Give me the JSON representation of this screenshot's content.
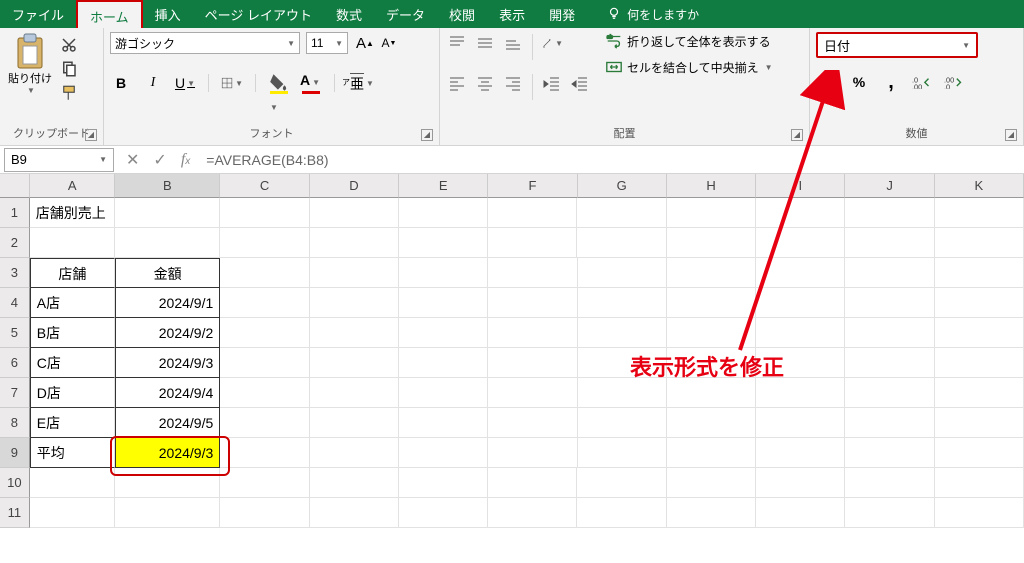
{
  "menubar": {
    "tabs": [
      "ファイル",
      "ホーム",
      "挿入",
      "ページ レイアウト",
      "数式",
      "データ",
      "校閲",
      "表示",
      "開発"
    ],
    "active_index": 1,
    "tellme": "何をしますか"
  },
  "ribbon": {
    "clipboard": {
      "paste_label": "貼り付け",
      "group_label": "クリップボード"
    },
    "font": {
      "name": "游ゴシック",
      "size": "11",
      "group_label": "フォント"
    },
    "alignment": {
      "wrap_label": "折り返して全体を表示する",
      "merge_label": "セルを結合して中央揃え",
      "group_label": "配置"
    },
    "number": {
      "format": "日付",
      "percent": "%",
      "comma": ",",
      "group_label": "数値"
    }
  },
  "formula_bar": {
    "name_box": "B9",
    "formula": "=AVERAGE(B4:B8)"
  },
  "grid": {
    "columns": [
      "A",
      "B",
      "C",
      "D",
      "E",
      "F",
      "G",
      "H",
      "I",
      "J",
      "K"
    ],
    "row_headers": [
      "1",
      "2",
      "3",
      "4",
      "5",
      "6",
      "7",
      "8",
      "9",
      "10",
      "11"
    ],
    "data": {
      "A1": "店舗別売上",
      "A3": "店舗",
      "B3": "金額",
      "A4": "A店",
      "B4": "2024/9/1",
      "A5": "B店",
      "B5": "2024/9/2",
      "A6": "C店",
      "B6": "2024/9/3",
      "A7": "D店",
      "B7": "2024/9/4",
      "A8": "E店",
      "B8": "2024/9/5",
      "A9": "平均",
      "B9": "2024/9/3"
    }
  },
  "annotation": {
    "text": "表示形式を修正"
  }
}
